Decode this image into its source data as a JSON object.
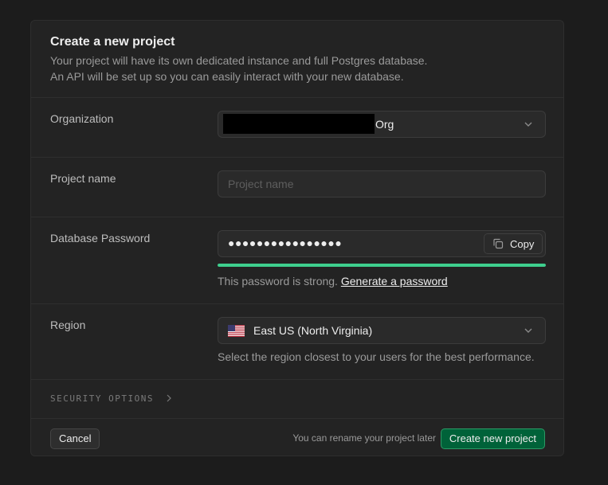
{
  "dialog": {
    "title": "Create a new project",
    "subtitle_line1": "Your project will have its own dedicated instance and full Postgres database.",
    "subtitle_line2": "An API will be set up so you can easily interact with your new database."
  },
  "organization": {
    "label": "Organization",
    "value_suffix": "Org"
  },
  "project_name": {
    "label": "Project name",
    "placeholder": "Project name",
    "value": ""
  },
  "database_password": {
    "label": "Database Password",
    "masked_value": "●●●●●●●●●●●●●●●●",
    "copy_label": "Copy",
    "strength_fraction": 1.0,
    "strength_color": "#3ecf8e",
    "strength_text": "This password is strong.",
    "generate_link": "Generate a password"
  },
  "region": {
    "label": "Region",
    "value": "East US (North Virginia)",
    "flag_icon": "us-flag-icon",
    "help_text": "Select the region closest to your users for the best performance."
  },
  "security_options": {
    "label": "SECURITY OPTIONS"
  },
  "footer": {
    "cancel_label": "Cancel",
    "rename_note": "You can rename your project later",
    "create_label": "Create new project",
    "accent_color": "#006239"
  }
}
